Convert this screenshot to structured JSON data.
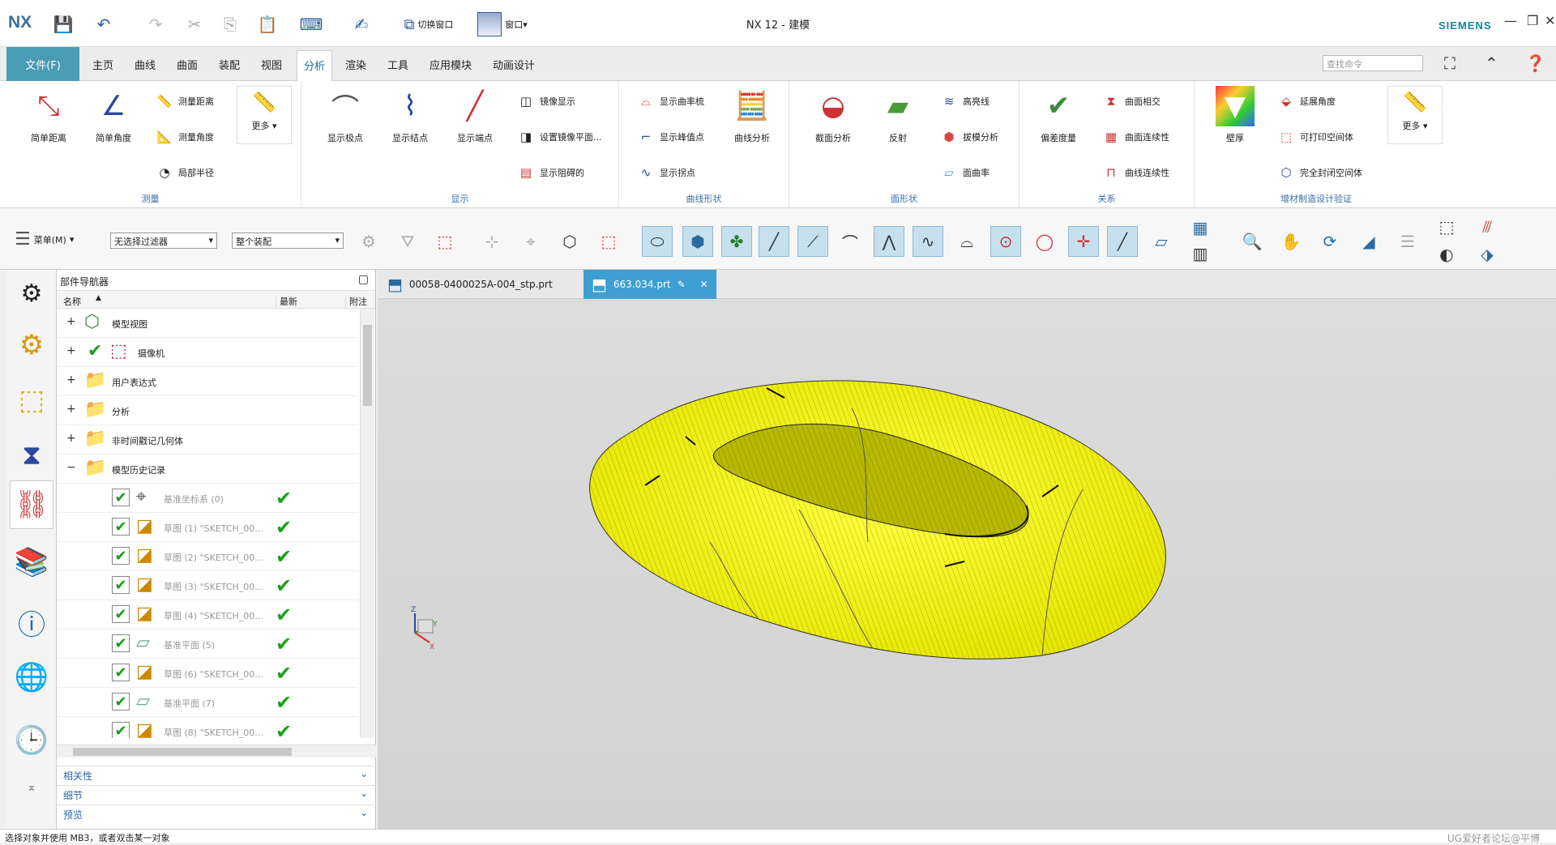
{
  "titlebar": {
    "logo": "NX",
    "title": "NX 12 - 建模",
    "brand": "SIEMENS",
    "switch_window": "切换窗口",
    "window": "窗口"
  },
  "menu": {
    "file": "文件(F)",
    "tabs": [
      "主页",
      "曲线",
      "曲面",
      "装配",
      "视图",
      "分析",
      "渲染",
      "工具",
      "应用模块",
      "动画设计"
    ],
    "active": "分析",
    "search_placeholder": "查找命令"
  },
  "ribbon": {
    "measure": {
      "label": "测量",
      "simple_distance": "简单距离",
      "simple_angle": "简单角度",
      "measure_distance": "测量距离",
      "measure_angle": "测量角度",
      "local_radius": "局部半径",
      "more": "更多"
    },
    "display": {
      "label": "显示",
      "show_poles": "显示极点",
      "show_knots": "显示结点",
      "show_endpoints": "显示端点",
      "mirror_display": "镜像显示",
      "set_mirror_plane": "设置镜像平面...",
      "show_snap": "显示阻碍的"
    },
    "curve_shape": {
      "label": "曲线形状",
      "show_comb": "显示曲率梳",
      "show_peak": "显示峰值点",
      "show_inflection": "显示拐点",
      "curve_analysis": "曲线分析"
    },
    "face_shape": {
      "label": "面形状",
      "section_analysis": "截面分析",
      "reflection": "反射",
      "highlight_lines": "高亮线",
      "draft_analysis": "拔模分析",
      "face_curvature": "面曲率"
    },
    "relation": {
      "label": "关系",
      "deviation": "偏差度量",
      "face_intersect": "曲面相交",
      "face_continuity": "曲面连续性",
      "curve_continuity": "曲线连续性"
    },
    "additive": {
      "label": "增材制造设计验证",
      "wall_thickness": "壁厚",
      "overhang": "延展角度",
      "printable_cavity": "可打印空间体",
      "enclosed_cavity": "完全封闭空间体",
      "more": "更多"
    }
  },
  "toolbar": {
    "menu": "菜单(M)",
    "filter": "无选择过滤器",
    "assembly": "整个装配"
  },
  "navigator": {
    "title": "部件导航器",
    "columns": {
      "name": "名称",
      "latest": "最新",
      "attached": "附注"
    },
    "rows": [
      {
        "label": "模型视图",
        "icon": "model-view-icon"
      },
      {
        "label": "摄像机",
        "icon": "camera-icon"
      },
      {
        "label": "用户表达式",
        "icon": "folder-icon"
      },
      {
        "label": "分析",
        "icon": "folder-icon"
      },
      {
        "label": "非时间戳记几何体",
        "icon": "folder-icon"
      },
      {
        "label": "模型历史记录",
        "icon": "folder-icon"
      },
      {
        "label": "基准坐标系 (0)",
        "icon": "csys-icon"
      },
      {
        "label": "草图 (1) \"SKETCH_00...",
        "icon": "sketch-icon"
      },
      {
        "label": "草图 (2) \"SKETCH_00...",
        "icon": "sketch-icon"
      },
      {
        "label": "草图 (3) \"SKETCH_00...",
        "icon": "sketch-icon"
      },
      {
        "label": "草图 (4) \"SKETCH_00...",
        "icon": "sketch-icon"
      },
      {
        "label": "基准平面 (5)",
        "icon": "plane-icon"
      },
      {
        "label": "草图 (6) \"SKETCH_00...",
        "icon": "sketch-icon"
      },
      {
        "label": "基准平面 (7)",
        "icon": "plane-icon"
      },
      {
        "label": "草图 (8) \"SKETCH_00...",
        "icon": "sketch-icon"
      }
    ],
    "sections": [
      "相关性",
      "细节",
      "预览"
    ]
  },
  "doctabs": [
    "00058-0400025A-004_stp.prt",
    "663.034.prt"
  ],
  "status": "选择对象并使用 MB3，或者双击某一对象",
  "watermark": "UG爱好者论坛@平博",
  "triad": {
    "z": "Z",
    "y": "Y",
    "x": "X"
  },
  "colors": {
    "accent": "#3d9fd2",
    "model": "#f2f200"
  }
}
